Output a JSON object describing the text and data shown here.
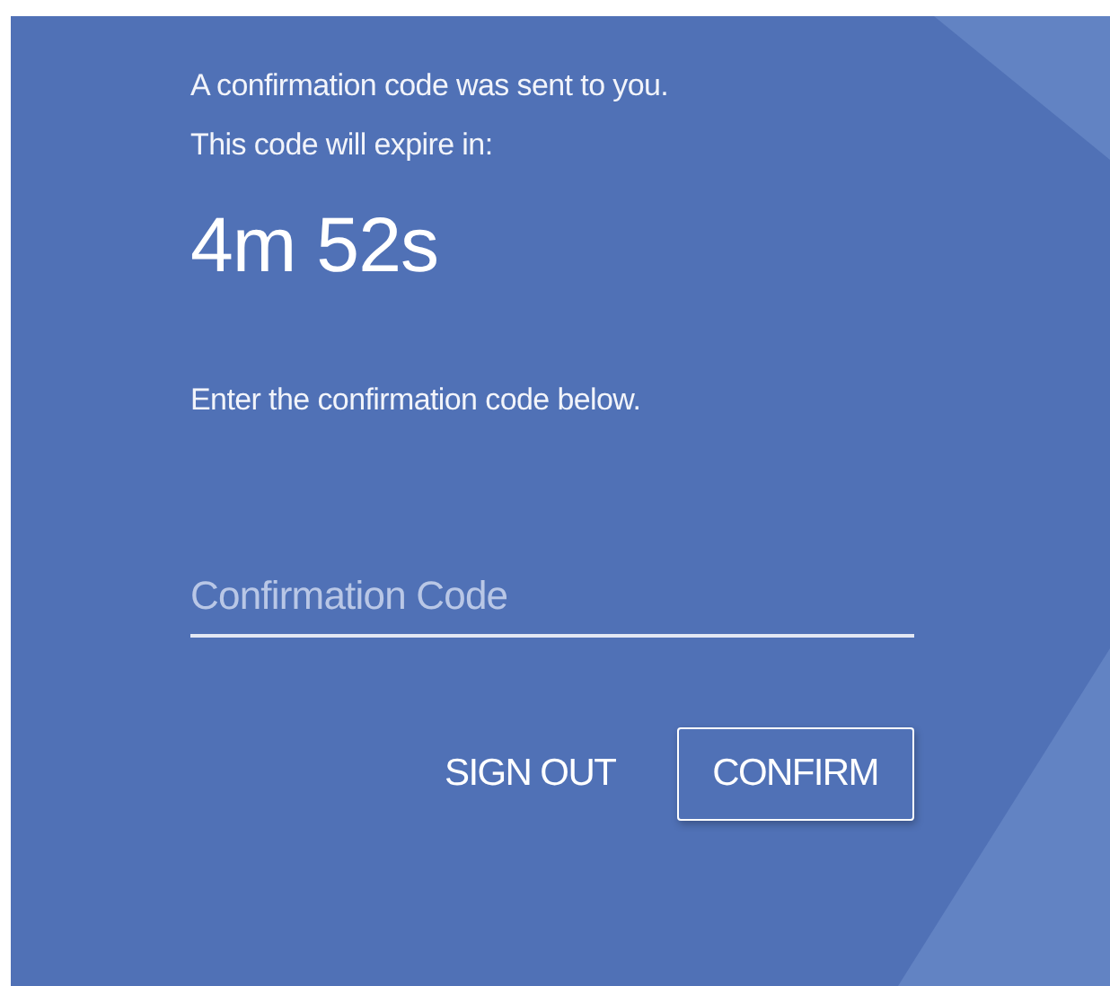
{
  "message_lines": [
    "A confirmation code was sent to you.",
    "This code will expire in:"
  ],
  "countdown": "4m 52s",
  "instruction": "Enter the confirmation code below.",
  "code_field": {
    "placeholder": "Confirmation Code"
  },
  "buttons": [
    {
      "label": "SIGN OUT",
      "kind": "text"
    },
    {
      "label": "CONFIRM",
      "kind": "outlined"
    }
  ]
}
